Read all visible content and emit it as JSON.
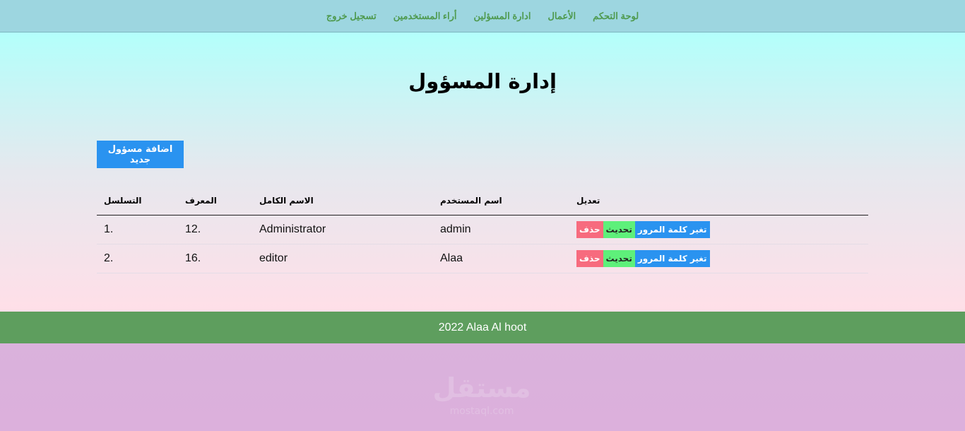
{
  "nav": {
    "items": [
      "لوحة التحكم",
      "الأعمال",
      "ادارة المسؤلين",
      "أراء المستخدمين",
      "تسجيل خروج"
    ]
  },
  "page": {
    "title": "إدارة المسؤول",
    "add_button": "اضافة مسؤول جديد"
  },
  "table": {
    "headers": [
      "التسلسل",
      "المعرف",
      "الاسم الكامل",
      "اسم المستخدم",
      "تعديل"
    ],
    "rows": [
      {
        "seq": "1.",
        "id": "12.",
        "full_name": "Administrator",
        "username": "admin"
      },
      {
        "seq": "2.",
        "id": "16.",
        "full_name": "editor",
        "username": "Alaa"
      }
    ],
    "actions": {
      "delete": "حذف",
      "update": "تحديث",
      "password": "تغير كلمة المرور"
    }
  },
  "footer": {
    "text": "2022 Alaa Al hoot"
  },
  "colors": {
    "navbar": "#9dd6e0",
    "nav_link": "#4f9a4f",
    "primary": "#2a93f0",
    "delete": "#f76b7e",
    "update": "#5ef07a",
    "footer": "#5e9e5e"
  },
  "watermark": {
    "text": "مستقل",
    "subtext": "mostaql.com"
  }
}
